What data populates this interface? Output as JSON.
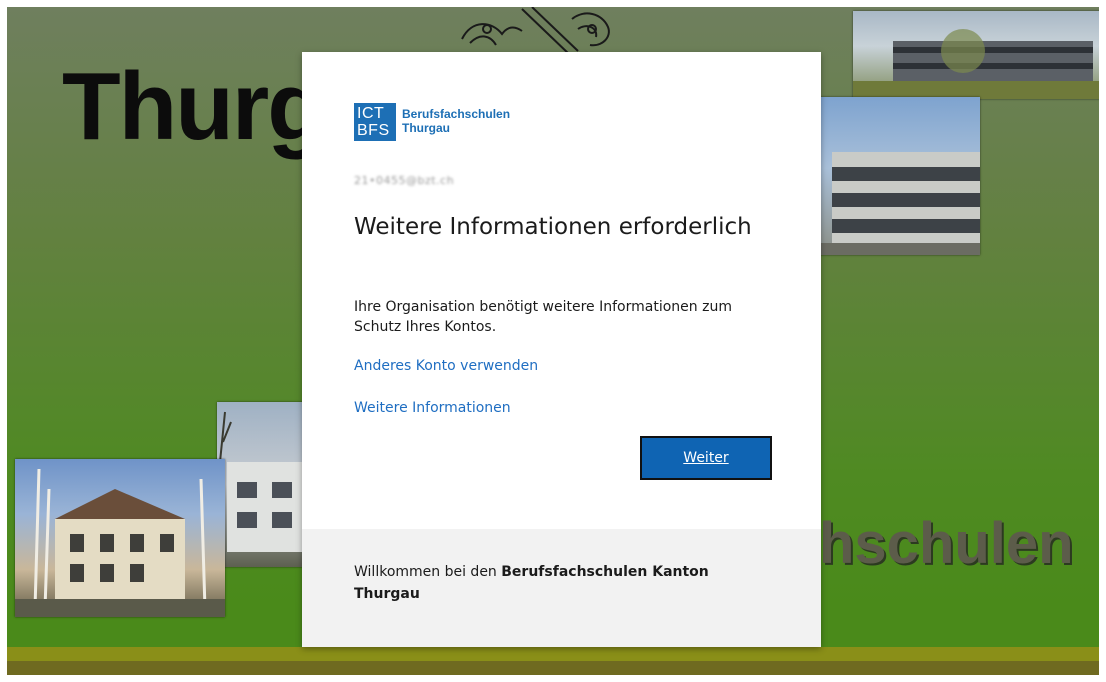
{
  "background": {
    "title": "Thurg",
    "subtitle": "hschulen",
    "colors": {
      "green": "#4f8a22",
      "strip": "#8a8f18"
    }
  },
  "logo": {
    "box_line1": "ICT",
    "box_line2": "BFS",
    "name_line1": "Berufsfachschulen",
    "name_line2": "Thurgau",
    "color": "#1d6fb5"
  },
  "account": {
    "email": "21•0455@bzt.ch"
  },
  "dialog": {
    "heading": "Weitere Informationen erforderlich",
    "description": "Ihre Organisation benötigt weitere Informationen zum Schutz Ihres Kontos.",
    "link_other_account": "Anderes Konto verwenden",
    "link_more_info": "Weitere Informationen",
    "next_button": "Weiter"
  },
  "footer": {
    "prefix": "Willkommen bei den ",
    "bold": "Berufsfachschulen Kanton Thurgau"
  },
  "colors": {
    "link": "#1f6ec2",
    "button": "#0f64b3",
    "footer_bg": "#f2f2f2"
  }
}
